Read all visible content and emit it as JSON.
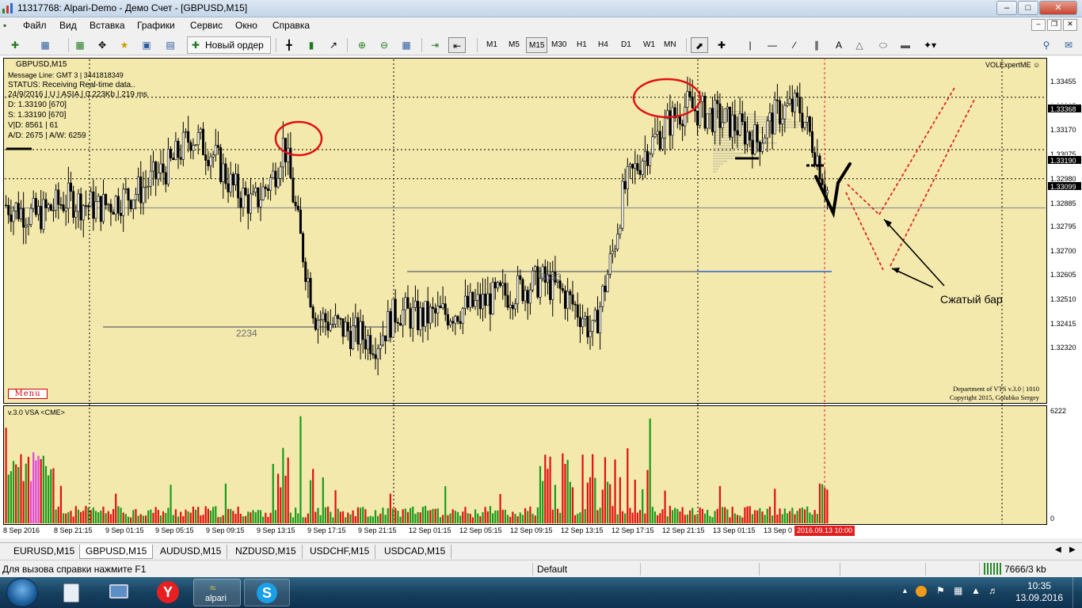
{
  "window": {
    "title": "11317768: Alpari-Demo - Демо Счет - [GBPUSD,M15]"
  },
  "menu": [
    "Файл",
    "Вид",
    "Вставка",
    "Графики",
    "Сервис",
    "Окно",
    "Справка"
  ],
  "toolbar": {
    "new_order": "Новый ордер",
    "timeframes": [
      "M1",
      "M5",
      "M15",
      "M30",
      "H1",
      "H4",
      "D1",
      "W1",
      "MN"
    ],
    "active_timeframe": "M15"
  },
  "chart": {
    "info": {
      "symbol": "GBPUSD,M15",
      "message": "Message Line: GMT 3 | 3441818349",
      "status": "STATUS:  Receiving Real-time data..",
      "meta": "24/9/2016 | U | ASIA | 0.223Kb | 219 ms",
      "d": "D: 1.33190 [670]",
      "s": "S: 1.33190  [670]",
      "vd": "V|D: 8561 | 61",
      "ad": "A/D: 2675 | A/W: 6259"
    },
    "expert": "VOLExpertME",
    "menu_label": "Menu",
    "credits": [
      "Department of VTS v.3.0 | 1010",
      "Copyright 2015, Golubko Sergey"
    ],
    "level_labels": [
      "2234",
      "8563"
    ],
    "annotation": "Сжатый бар",
    "vsa_label": "v.3.0 VSA <CME>",
    "volume_max": "6222",
    "volume_zero": "0",
    "price_ticks": [
      "1.33455",
      "1.33265",
      "1.33170",
      "1.33075",
      "1.32980",
      "1.32885",
      "1.32795",
      "1.32700",
      "1.32605",
      "1.32510",
      "1.32415",
      "1.32320"
    ],
    "price_boxes": [
      "1.33368",
      "1.33190",
      "1.33099"
    ],
    "time_labels": [
      "8 Sep 2016",
      "8 Sep 21:15",
      "9 Sep 01:15",
      "9 Sep 05:15",
      "9 Sep 09:15",
      "9 Sep 13:15",
      "9 Sep 17:15",
      "9 Sep 21:15",
      "12 Sep 01:15",
      "12 Sep 05:15",
      "12 Sep 09:15",
      "12 Sep 13:15",
      "12 Sep 17:15",
      "12 Sep 21:15",
      "13 Sep 01:15",
      "13 Sep 0"
    ],
    "current_time": "2016.09.13 10:00"
  },
  "tabs": [
    "EURUSD,M15",
    "GBPUSD,M15",
    "AUDUSD,M15",
    "NZDUSD,M15",
    "USDCHF,M15",
    "USDCAD,M15"
  ],
  "active_tab": "GBPUSD,M15",
  "status": {
    "help": "Для вызова справки нажмите F1",
    "profile": "Default",
    "traffic": "7666/3 kb"
  },
  "taskbar": {
    "time": "10:35",
    "date": "13.09.2016",
    "alpari": "alpari"
  },
  "chart_data": {
    "type": "candlestick",
    "symbol": "GBPUSD",
    "timeframe": "M15",
    "ylim": [
      1.3232,
      1.335
    ],
    "close_path": [
      [
        0,
        1.33
      ],
      [
        0.03,
        1.3296
      ],
      [
        0.06,
        1.3302
      ],
      [
        0.09,
        1.3299
      ],
      [
        0.13,
        1.3305
      ],
      [
        0.16,
        1.3314
      ],
      [
        0.18,
        1.3324
      ],
      [
        0.2,
        1.3318
      ],
      [
        0.22,
        1.3306
      ],
      [
        0.24,
        1.33
      ],
      [
        0.26,
        1.331
      ],
      [
        0.27,
        1.3322
      ],
      [
        0.285,
        1.329
      ],
      [
        0.3,
        1.3262
      ],
      [
        0.33,
        1.3257
      ],
      [
        0.36,
        1.3253
      ],
      [
        0.38,
        1.3264
      ],
      [
        0.4,
        1.3261
      ],
      [
        0.43,
        1.3263
      ],
      [
        0.46,
        1.3266
      ],
      [
        0.49,
        1.327
      ],
      [
        0.52,
        1.3274
      ],
      [
        0.54,
        1.327
      ],
      [
        0.56,
        1.3262
      ],
      [
        0.57,
        1.3255
      ],
      [
        0.59,
        1.3285
      ],
      [
        0.6,
        1.3305
      ],
      [
        0.62,
        1.3318
      ],
      [
        0.64,
        1.3327
      ],
      [
        0.66,
        1.3334
      ],
      [
        0.69,
        1.333
      ],
      [
        0.71,
        1.3327
      ],
      [
        0.73,
        1.3322
      ],
      [
        0.75,
        1.3332
      ],
      [
        0.77,
        1.3334
      ],
      [
        0.785,
        1.332
      ],
      [
        0.8,
        1.3302
      ]
    ],
    "levels": [
      1.3337,
      1.3319,
      1.3309,
      1.3299
    ],
    "lines": [
      {
        "label": "2234",
        "price": 1.3261
      },
      {
        "label": "8563",
        "price": 1.3279
      }
    ]
  }
}
